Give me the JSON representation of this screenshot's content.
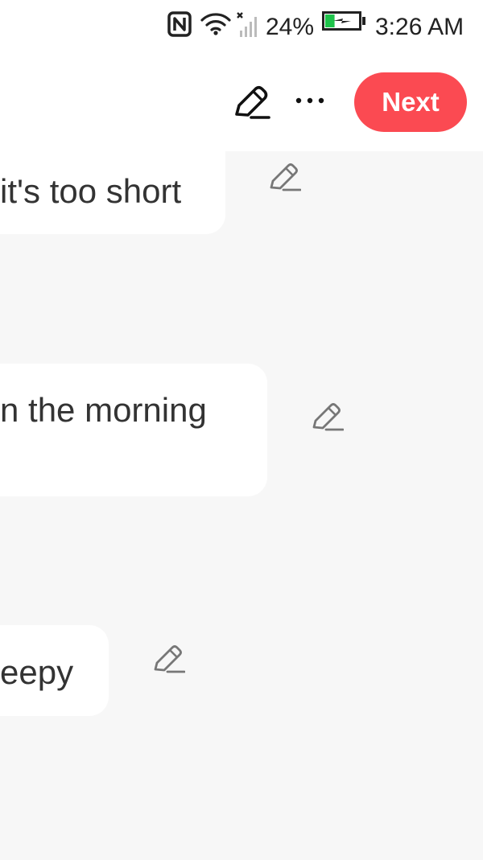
{
  "status_bar": {
    "battery_percent": "24%",
    "time": "3:26 AM",
    "icons": [
      "nfc-icon",
      "wifi-icon",
      "no-signal-icon",
      "battery-charging-icon"
    ],
    "battery_level": 0.24
  },
  "toolbar": {
    "edit_icon": "pencil-icon",
    "more_icon": "more-dots-icon",
    "next_label": "Next",
    "accent_color": "#fb4a52"
  },
  "messages": [
    {
      "text": "it's too short",
      "edit_icon": "pencil-icon"
    },
    {
      "text": "n the morning",
      "edit_icon": "pencil-icon"
    },
    {
      "text": "eepy",
      "edit_icon": "pencil-icon"
    }
  ]
}
